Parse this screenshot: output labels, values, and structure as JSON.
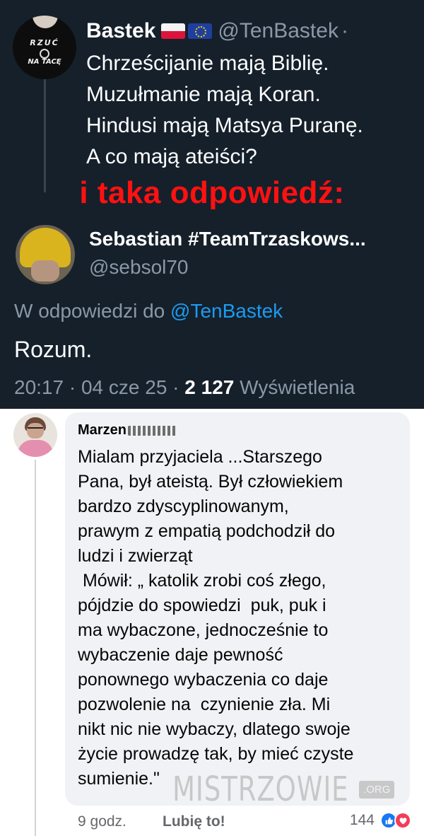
{
  "tweet": {
    "author_name": "Bastek",
    "handle": "@TenBastek",
    "separator": "·",
    "lines": [
      "Chrześcijanie mają Biblię.",
      "Muzułmanie mają Koran.",
      "Hindusi mają Matsya Puranę.",
      "A co mają ateiści?"
    ],
    "avatar_text_top": "RZUĆ",
    "avatar_text_bottom": "NA TACĘ"
  },
  "overlay_title": "i taka odpowiedź:",
  "reply": {
    "author_name": "Sebastian #TeamTrzaskows...",
    "handle": "@sebsol70",
    "in_reply_prefix": "W odpowiedzi do ",
    "in_reply_handle": "@TenBastek",
    "body": "Rozum.",
    "time": "20:17",
    "date": "04 cze 25",
    "views": "2 127",
    "views_label": "Wyświetlenia",
    "dot": " · "
  },
  "comment": {
    "author": "Marzen",
    "lines": [
      "Mialam przyjaciela ...Starszego",
      "Pana, był ateistą. Był człowiekiem",
      "bardzo zdyscyplinowanym,",
      "prawym z empatią podchodził do",
      "ludzi i zwierząt",
      " Mówił: „ katolik zrobi coś złego,",
      "pójdzie do spowiedzi  puk, puk i",
      "ma wybaczone, jednocześnie to",
      "wybaczenie daje pewność",
      "ponownego wybaczenia co daje",
      "pozwolenie na  czynienie zła. Mi",
      "nikt nic nie wybaczy, dlatego swoje",
      "życie prowadzę tak, by mieć czyste",
      "sumienie.\""
    ],
    "time": "9 godz.",
    "like_label": "Lubię to!",
    "reaction_count": "144"
  },
  "watermark": {
    "main": "MISTRZOWIE",
    "suffix": ".ORG"
  },
  "colors": {
    "twitter_bg": "#15202b",
    "link_blue": "#1d9bf0",
    "overlay_red": "#ff1111",
    "fb_bubble": "#f0f2f5"
  },
  "icons": [
    "flag-poland-icon",
    "flag-eu-icon",
    "like-reaction-icon",
    "love-reaction-icon"
  ]
}
